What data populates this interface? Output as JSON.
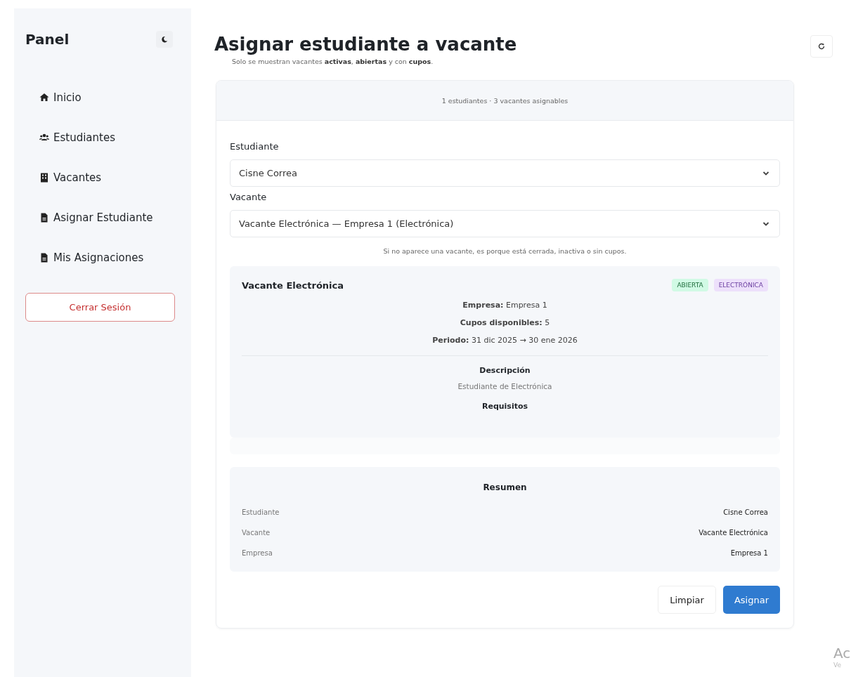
{
  "sidebar": {
    "title": "Panel",
    "items": [
      {
        "kind": "home",
        "label": "Inicio"
      },
      {
        "kind": "users",
        "label": "Estudiantes"
      },
      {
        "kind": "building",
        "label": "Vacantes"
      },
      {
        "kind": "file",
        "label": "Asignar Estudiante"
      },
      {
        "kind": "file",
        "label": "Mis Asignaciones"
      }
    ],
    "logout": "Cerrar Sesión"
  },
  "header": {
    "title": "Asignar estudiante a vacante",
    "subtitle": "Solo se muestran vacantes **activas**, **abiertas** y con **cupos**."
  },
  "card": {
    "summary": "1 estudiantes · 3 vacantes asignables",
    "fields": [
      {
        "label": "Estudiante",
        "value": "Cisne Correa"
      },
      {
        "label": "Vacante",
        "value": "Vacante Electrónica — Empresa 1 (Electrónica)",
        "hint": "Si no aparece una vacante, es porque está cerrada, inactiva o sin cupos."
      }
    ],
    "vacancy": {
      "title": "Vacante Electrónica",
      "tags": [
        {
          "text": "ABIERTA",
          "color": "#d1fae5"
        },
        {
          "text": "ELECTRÓNICA",
          "color": "#ede0fb"
        }
      ],
      "details": [
        "**Empresa:** Empresa 1",
        "**Cupos disponibles:** 5",
        "**Periodo:** 31 dic 2025 → 30 ene 2026"
      ],
      "description_title": "Descripción",
      "description": "Estudiante de Electrónica",
      "requirements_title": "Requisitos"
    },
    "resumen": {
      "title": "Resumen",
      "rows": [
        {
          "label": "Estudiante",
          "value": "Cisne Correa"
        },
        {
          "label": "Vacante",
          "value": "Vacante Electrónica"
        },
        {
          "label": "Empresa",
          "value": "Empresa 1"
        }
      ]
    },
    "buttons": [
      {
        "kind": "secondary",
        "label": "Limpiar"
      },
      {
        "kind": "primary",
        "label": "Asignar"
      }
    ]
  },
  "os_overlay": [
    "Ac",
    "Ve"
  ]
}
